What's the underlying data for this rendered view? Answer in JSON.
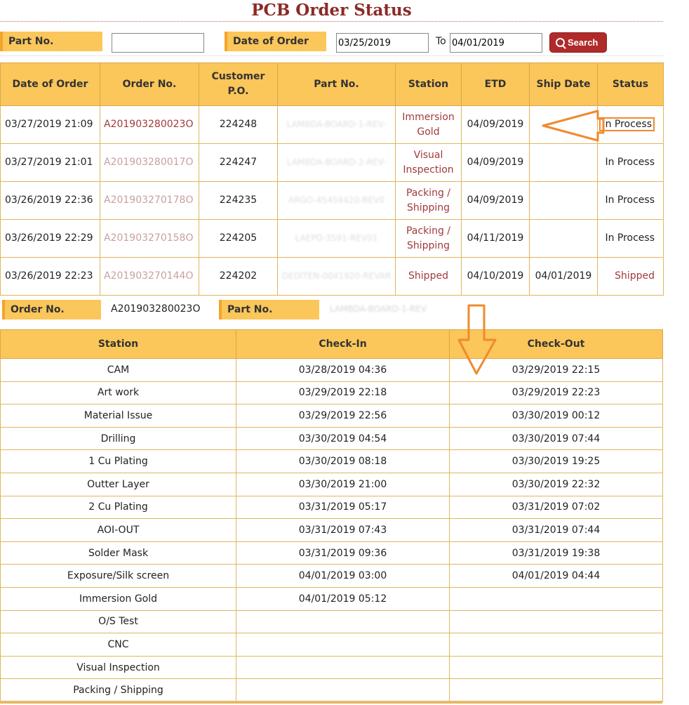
{
  "page_title": "PCB Order Status",
  "search": {
    "part_no_label": "Part No.",
    "part_no_value": "",
    "date_label": "Date of Order",
    "date_from": "03/25/2019",
    "to_label": "To",
    "date_to": "04/01/2019",
    "button_label": "Search"
  },
  "orders": {
    "headers": [
      "Date of Order",
      "Order No.",
      "Customer P.O.",
      "Part No.",
      "Station",
      "ETD",
      "Ship Date",
      "Status"
    ],
    "rows": [
      {
        "date": "03/27/2019 21:09",
        "order_no": "A201903280023O",
        "po": "224248",
        "part_no": "LAMBDA-BOARD-1-REV-",
        "station": "Immersion Gold",
        "etd": "04/09/2019",
        "ship_date": "",
        "status": "In Process"
      },
      {
        "date": "03/27/2019 21:01",
        "order_no": "A201903280017O",
        "po": "224247",
        "part_no": "LAMBDA-BOARD-2-REV-",
        "station": "Visual Inspection",
        "etd": "04/09/2019",
        "ship_date": "",
        "status": "In Process"
      },
      {
        "date": "03/26/2019 22:36",
        "order_no": "A201903270178O",
        "po": "224235",
        "part_no": "ARGO-45454420-REV0",
        "station": "Packing / Shipping",
        "etd": "04/09/2019",
        "ship_date": "",
        "status": "In Process"
      },
      {
        "date": "03/26/2019 22:29",
        "order_no": "A201903270158O",
        "po": "224205",
        "part_no": "LAEPD-3591-REV01",
        "station": "Packing / Shipping",
        "etd": "04/11/2019",
        "ship_date": "",
        "status": "In Process"
      },
      {
        "date": "03/26/2019 22:23",
        "order_no": "A201903270144O",
        "po": "224202",
        "part_no": "DEDITEN-0041920-REVAR",
        "station": "Shipped",
        "etd": "04/10/2019",
        "ship_date": "04/01/2019",
        "status": "Shipped"
      }
    ]
  },
  "detail": {
    "order_no_label": "Order No.",
    "order_no_value": "A201903280023O",
    "part_no_label": "Part No.",
    "part_no_value": "LAMBDA-BOARD-1-REV",
    "headers": [
      "Station",
      "Check-In",
      "Check-Out"
    ],
    "rows": [
      {
        "station": "CAM",
        "check_in": "03/28/2019 04:36",
        "check_out": "03/29/2019 22:15"
      },
      {
        "station": "Art work",
        "check_in": "03/29/2019 22:18",
        "check_out": "03/29/2019 22:23"
      },
      {
        "station": "Material Issue",
        "check_in": "03/29/2019 22:56",
        "check_out": "03/30/2019 00:12"
      },
      {
        "station": "Drilling",
        "check_in": "03/30/2019 04:54",
        "check_out": "03/30/2019 07:44"
      },
      {
        "station": "1 Cu Plating",
        "check_in": "03/30/2019 08:18",
        "check_out": "03/30/2019 19:25"
      },
      {
        "station": "Outter Layer",
        "check_in": "03/30/2019 21:00",
        "check_out": "03/30/2019 22:32"
      },
      {
        "station": "2 Cu Plating",
        "check_in": "03/31/2019 05:17",
        "check_out": "03/31/2019 07:02"
      },
      {
        "station": "AOI-OUT",
        "check_in": "03/31/2019 07:43",
        "check_out": "03/31/2019 07:44"
      },
      {
        "station": "Solder Mask",
        "check_in": "03/31/2019 09:36",
        "check_out": "03/31/2019 19:38"
      },
      {
        "station": "Exposure/Silk screen",
        "check_in": "04/01/2019 03:00",
        "check_out": "04/01/2019 04:44"
      },
      {
        "station": "Immersion Gold",
        "check_in": "04/01/2019 05:12",
        "check_out": ""
      },
      {
        "station": "O/S Test",
        "check_in": "",
        "check_out": ""
      },
      {
        "station": "CNC",
        "check_in": "",
        "check_out": ""
      },
      {
        "station": "Visual Inspection",
        "check_in": "",
        "check_out": ""
      },
      {
        "station": "Packing / Shipping",
        "check_in": "",
        "check_out": ""
      }
    ]
  },
  "colors": {
    "header_bg": "#fbc65a",
    "title_color": "#8b2a26",
    "search_button": "#b12a2a",
    "annotation_arrow": "#f08a2e"
  },
  "icons": {
    "search_button_icon": "magnifier-icon",
    "annotation_arrows": [
      "left-arrow-icon",
      "down-arrow-icon"
    ]
  }
}
